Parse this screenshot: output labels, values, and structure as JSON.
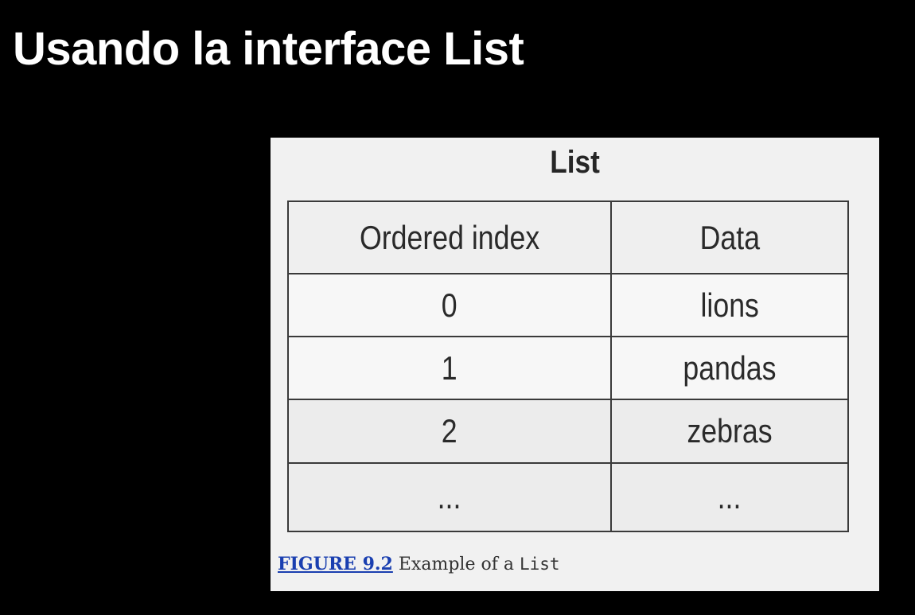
{
  "slide": {
    "title": "Usando la interface List"
  },
  "figure": {
    "heading": "List",
    "table": {
      "headers": [
        "Ordered index",
        "Data"
      ],
      "rows": [
        [
          "0",
          "lions"
        ],
        [
          "1",
          "pandas"
        ],
        [
          "2",
          "zebras"
        ],
        [
          "...",
          "..."
        ]
      ]
    },
    "caption": {
      "label": "FIGURE 9.2",
      "text": "Example of a",
      "code": "List"
    }
  }
}
